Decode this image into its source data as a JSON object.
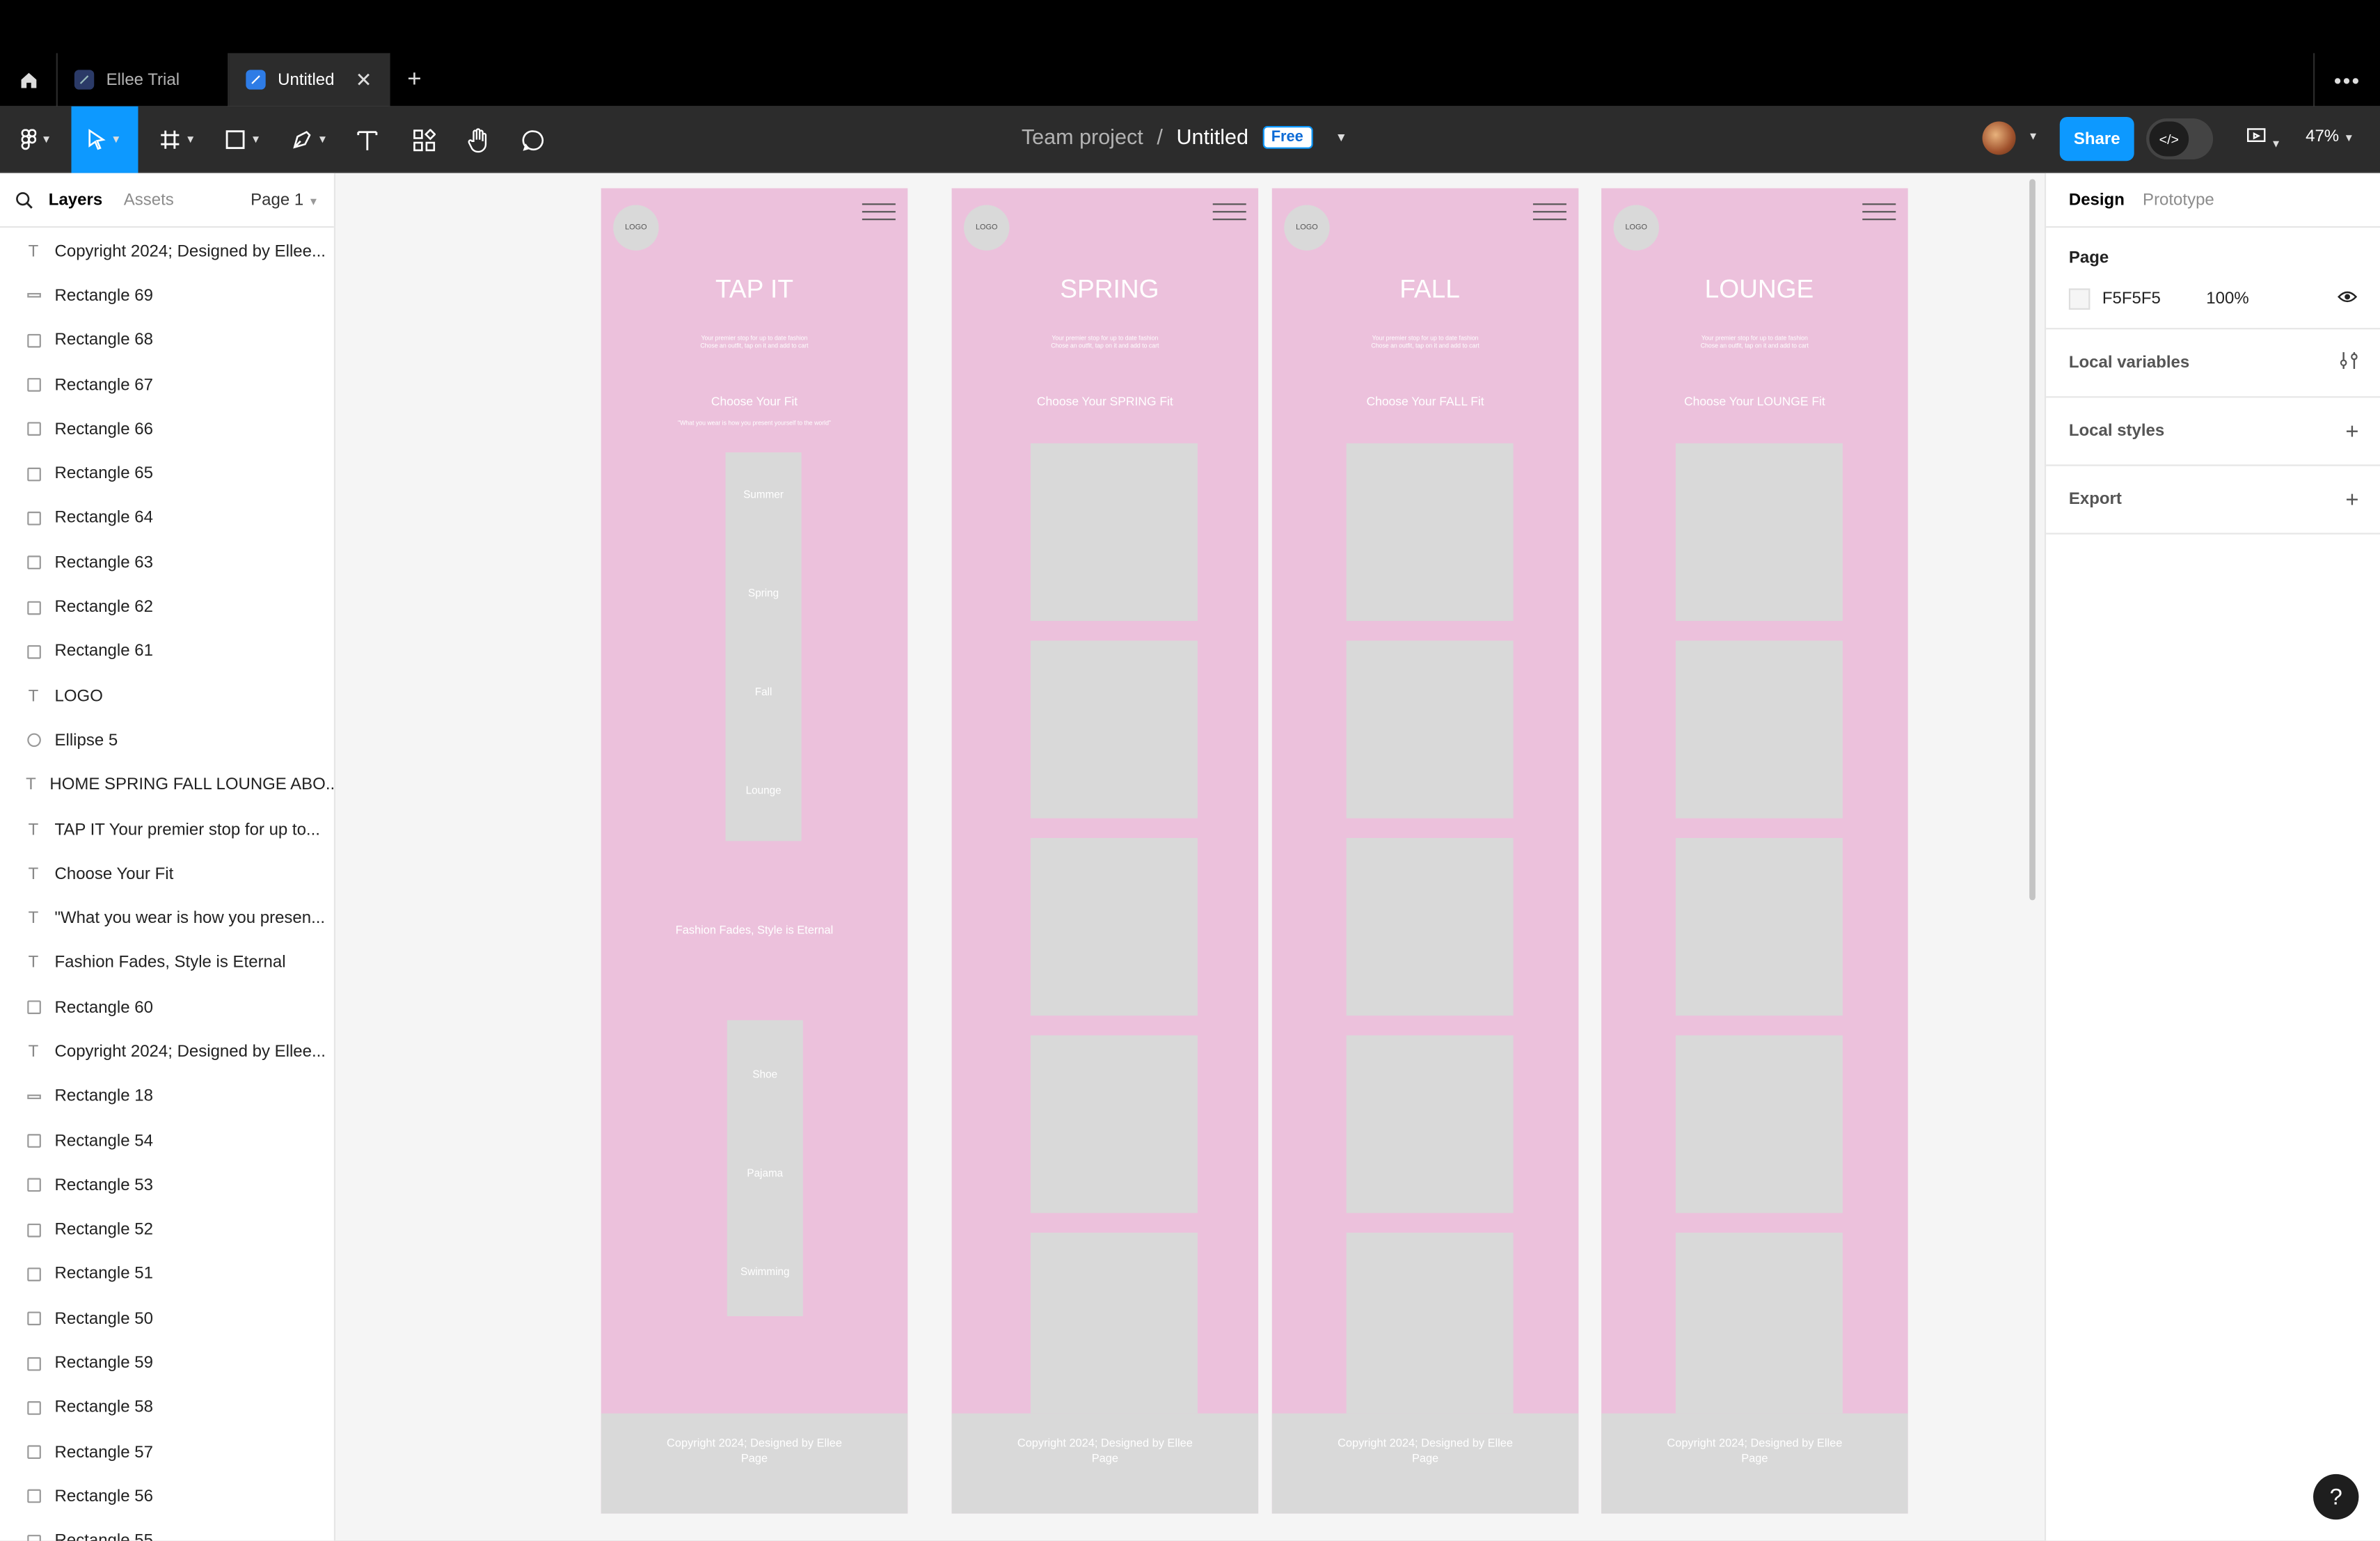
{
  "tabs": [
    {
      "label": "Ellee Trial"
    },
    {
      "label": "Untitled"
    }
  ],
  "header": {
    "project": "Team project",
    "separator": "/",
    "file": "Untitled",
    "plan": "Free",
    "zoom": "47%",
    "share": "Share"
  },
  "left_panel": {
    "tab_layers": "Layers",
    "tab_assets": "Assets",
    "page": "Page 1",
    "layers": [
      {
        "type": "text",
        "name": "Copyright 2024; Designed by Ellee..."
      },
      {
        "type": "line",
        "name": "Rectangle 69"
      },
      {
        "type": "rect",
        "name": "Rectangle 68"
      },
      {
        "type": "rect",
        "name": "Rectangle 67"
      },
      {
        "type": "rect",
        "name": "Rectangle 66"
      },
      {
        "type": "rect",
        "name": "Rectangle 65"
      },
      {
        "type": "rect",
        "name": "Rectangle 64"
      },
      {
        "type": "rect",
        "name": "Rectangle 63"
      },
      {
        "type": "rect",
        "name": "Rectangle 62"
      },
      {
        "type": "rect",
        "name": "Rectangle 61"
      },
      {
        "type": "text",
        "name": "LOGO"
      },
      {
        "type": "ellipse",
        "name": "Ellipse 5"
      },
      {
        "type": "text",
        "name": "HOME SPRING FALL LOUNGE ABO..."
      },
      {
        "type": "text",
        "name": "TAP IT Your premier stop for up to..."
      },
      {
        "type": "text",
        "name": "Choose Your Fit"
      },
      {
        "type": "text",
        "name": "\"What you wear is how you presen..."
      },
      {
        "type": "text",
        "name": "Fashion Fades, Style is Eternal"
      },
      {
        "type": "rect",
        "name": "Rectangle 60"
      },
      {
        "type": "text",
        "name": "Copyright 2024; Designed by Ellee..."
      },
      {
        "type": "line",
        "name": "Rectangle 18"
      },
      {
        "type": "rect",
        "name": "Rectangle 54"
      },
      {
        "type": "rect",
        "name": "Rectangle 53"
      },
      {
        "type": "rect",
        "name": "Rectangle 52"
      },
      {
        "type": "rect",
        "name": "Rectangle 51"
      },
      {
        "type": "rect",
        "name": "Rectangle 50"
      },
      {
        "type": "rect",
        "name": "Rectangle 59"
      },
      {
        "type": "rect",
        "name": "Rectangle 58"
      },
      {
        "type": "rect",
        "name": "Rectangle 57"
      },
      {
        "type": "rect",
        "name": "Rectangle 56"
      },
      {
        "type": "rect",
        "name": "Rectangle 55"
      }
    ]
  },
  "frames": [
    {
      "logo": "LOGO",
      "title": "TAP IT",
      "subtitle_line1": "Your premier stop for up to date fashion",
      "subtitle_line2": "Chose an outfit, tap on it and add to cart",
      "choose": "Choose Your Fit",
      "quote": "\"What you wear is how you present yourself to the world\"",
      "categories": [
        "Summer",
        "Spring",
        "Fall",
        "Lounge"
      ],
      "fades": "Fashion Fades, Style is Eternal",
      "categories2": [
        "Shoe",
        "Pajama",
        "Swimming"
      ],
      "footer": "Copyright 2024; Designed by Ellee Page"
    },
    {
      "logo": "LOGO",
      "title": "SPRING",
      "subtitle_line1": "Your premier stop for up to date fashion",
      "subtitle_line2": "Chose an outfit, tap on it and add to cart",
      "choose": "Choose Your SPRING Fit",
      "footer": "Copyright 2024; Designed by Ellee Page"
    },
    {
      "logo": "LOGO",
      "title": "FALL",
      "subtitle_line1": "Your premier stop for up to date fashion",
      "subtitle_line2": "Chose an outfit, tap on it and add to cart",
      "choose": "Choose Your FALL Fit",
      "footer": "Copyright 2024; Designed by Ellee Page"
    },
    {
      "logo": "LOGO",
      "title": "LOUNGE",
      "subtitle_line1": "Your premier stop for up to date fashion",
      "subtitle_line2": "Chose an outfit, tap on it and add to cart",
      "choose": "Choose Your LOUNGE Fit",
      "footer": "Copyright 2024; Designed by Ellee Page"
    }
  ],
  "right_panel": {
    "tab_design": "Design",
    "tab_prototype": "Prototype",
    "page_label": "Page",
    "page_color": "F5F5F5",
    "page_opacity": "100%",
    "local_variables": "Local variables",
    "local_styles": "Local styles",
    "export": "Export"
  },
  "help": "?",
  "colors": {
    "accent": "#0d99ff",
    "frame_pink": "#ecc1dc",
    "placeholder_gray": "#d9d9d9",
    "canvas": "#f5f5f5"
  }
}
